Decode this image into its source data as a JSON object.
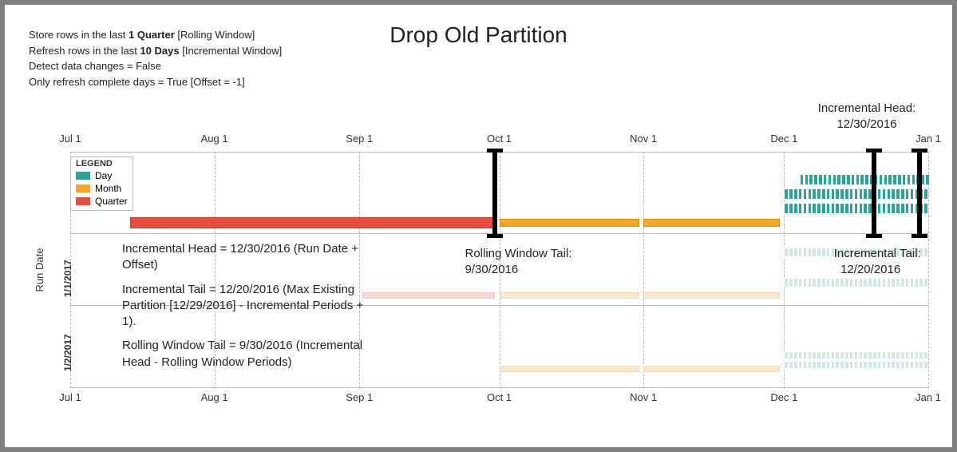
{
  "title": "Drop Old Partition",
  "config": {
    "line1_pre": "Store rows in the last ",
    "line1_bold": "1 Quarter",
    "line1_post": " [Rolling Window]",
    "line2_pre": "Refresh rows in the last ",
    "line2_bold": "10 Days",
    "line2_post": " [Incremental Window]",
    "line3": "Detect data changes = False",
    "line4": "Only refresh complete days = True [Offset = -1]"
  },
  "legend": {
    "header": "LEGEND",
    "day": "Day",
    "month": "Month",
    "quarter": "Quarter"
  },
  "y_axis_title": "Run Date",
  "x_ticks": [
    "Jul 1",
    "Aug 1",
    "Sep 1",
    "Oct 1",
    "Nov 1",
    "Dec 1",
    "Jan 1"
  ],
  "row_labels": [
    "1/1/2017",
    "1/2/2017"
  ],
  "annotations": {
    "incremental_head_label": "Incremental Head:",
    "incremental_head_value": "12/30/2016",
    "rolling_tail_label": "Rolling Window Tail:",
    "rolling_tail_value": "9/30/2016",
    "incremental_tail_label": "Incremental Tail:",
    "incremental_tail_value": "12/20/2016"
  },
  "calc": {
    "p1": "Incremental Head = 12/30/2016 (Run Date + Offset)",
    "p2": "Incremental Tail = 12/20/2016 (Max Existing Partition [12/29/2016] - Incremental Periods + 1).",
    "p3": "Rolling Window Tail = 9/30/2016 (Incremental Head - Rolling Window Periods)"
  },
  "chart_data": {
    "type": "timeline-gantt",
    "x_domain": [
      "2016-07-01",
      "2017-01-01"
    ],
    "rows": [
      {
        "run_date": "emphasized (current)",
        "quarters": [
          [
            "2016-07-01",
            "2016-09-30"
          ]
        ],
        "months": [
          [
            "2016-10-01",
            "2016-10-31"
          ],
          [
            "2016-11-01",
            "2016-11-30"
          ]
        ],
        "day_rows": [
          [
            "2016-12-05",
            "2017-01-01"
          ],
          [
            "2016-12-01",
            "2017-01-01"
          ],
          [
            "2016-12-01",
            "2017-01-01"
          ]
        ],
        "markers": {
          "rolling_tail": "2016-09-30",
          "incremental_tail": "2016-12-20",
          "incremental_head": "2016-12-30"
        }
      },
      {
        "run_date": "1/1/2017",
        "faded": true,
        "quarters": [
          [
            "2016-07-01",
            "2016-09-30"
          ]
        ],
        "months": [
          [
            "2016-10-01",
            "2016-10-31"
          ],
          [
            "2016-11-01",
            "2016-11-30"
          ]
        ],
        "day_rows": [
          [
            "2016-12-01",
            "2017-01-01"
          ],
          [
            "2016-12-01",
            "2017-01-01"
          ]
        ]
      },
      {
        "run_date": "1/2/2017",
        "faded": true,
        "months": [
          [
            "2016-10-01",
            "2016-10-31"
          ],
          [
            "2016-11-01",
            "2016-11-30"
          ]
        ],
        "day_rows": [
          [
            "2016-12-01",
            "2017-01-01"
          ],
          [
            "2016-12-01",
            "2017-01-01"
          ]
        ]
      }
    ]
  }
}
